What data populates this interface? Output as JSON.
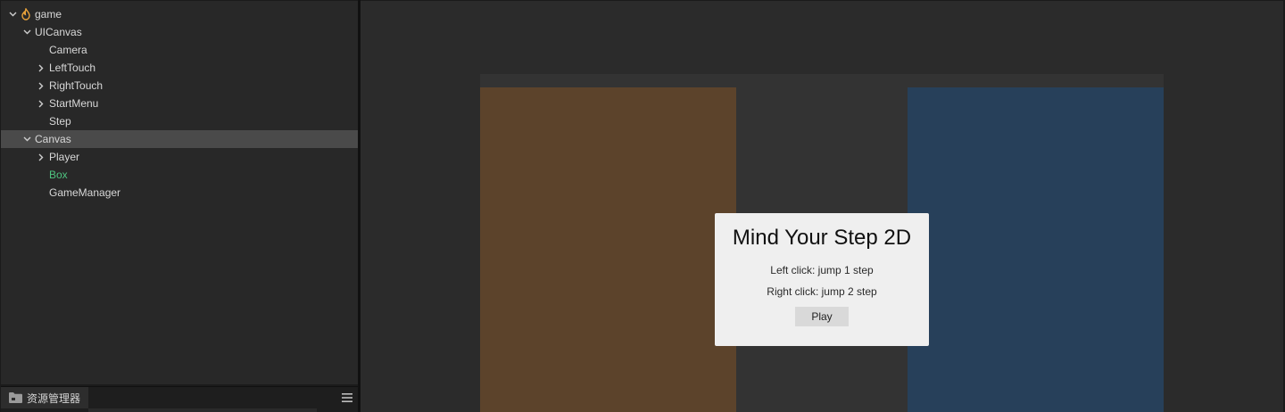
{
  "hierarchy": {
    "nodes": [
      {
        "label": "game",
        "depth": 0,
        "expandable": true,
        "expanded": true,
        "icon": "flame-icon"
      },
      {
        "label": "UICanvas",
        "depth": 1,
        "expandable": true,
        "expanded": true
      },
      {
        "label": "Camera",
        "depth": 2,
        "expandable": false
      },
      {
        "label": "LeftTouch",
        "depth": 2,
        "expandable": true,
        "expanded": false
      },
      {
        "label": "RightTouch",
        "depth": 2,
        "expandable": true,
        "expanded": false
      },
      {
        "label": "StartMenu",
        "depth": 2,
        "expandable": true,
        "expanded": false
      },
      {
        "label": "Step",
        "depth": 2,
        "expandable": false
      },
      {
        "label": "Canvas",
        "depth": 1,
        "expandable": true,
        "expanded": true,
        "selected": true
      },
      {
        "label": "Player",
        "depth": 2,
        "expandable": true,
        "expanded": false
      },
      {
        "label": "Box",
        "depth": 2,
        "expandable": false,
        "color": "#4ec37f"
      },
      {
        "label": "GameManager",
        "depth": 2,
        "expandable": false
      }
    ]
  },
  "assets": {
    "tab_label": "资源管理器",
    "tab_icon": "folder-icon",
    "menu_icon": "hamburger-menu-icon"
  },
  "scene": {
    "left_column_color": "#5c432b",
    "right_column_color": "#27405a",
    "start_menu": {
      "title": "Mind Your Step 2D",
      "line1": "Left click: jump 1 step",
      "line2": "Right click: jump 2 step",
      "play_label": "Play"
    }
  },
  "colors": {
    "selected_row": "#4a4a4a",
    "highlight_text": "#4ec37f",
    "panel_bg": "#282828"
  }
}
